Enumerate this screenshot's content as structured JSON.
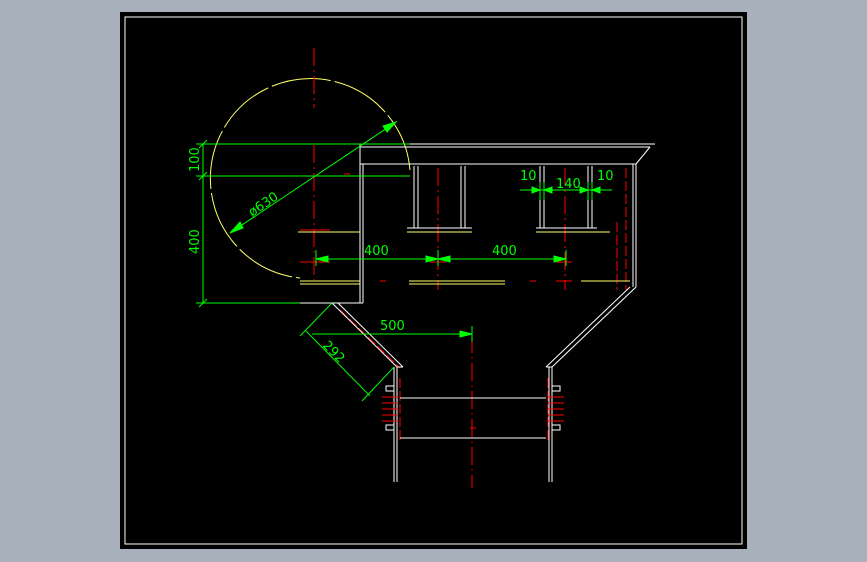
{
  "colors": {
    "background": "#a7b0bb",
    "sheet": "#000000",
    "outline": "#ffffff",
    "dimension": "#00ff00",
    "centerline": "#ff0000",
    "circle": "#ffff66"
  },
  "dimensions": {
    "d_100": "100",
    "d_400_vertical": "400",
    "d_dia630": "ø630",
    "d_400_left": "400",
    "d_400_right": "400",
    "d_10_left": "10",
    "d_140": "140",
    "d_10_right": "10",
    "d_500": "500",
    "d_292": "292"
  }
}
